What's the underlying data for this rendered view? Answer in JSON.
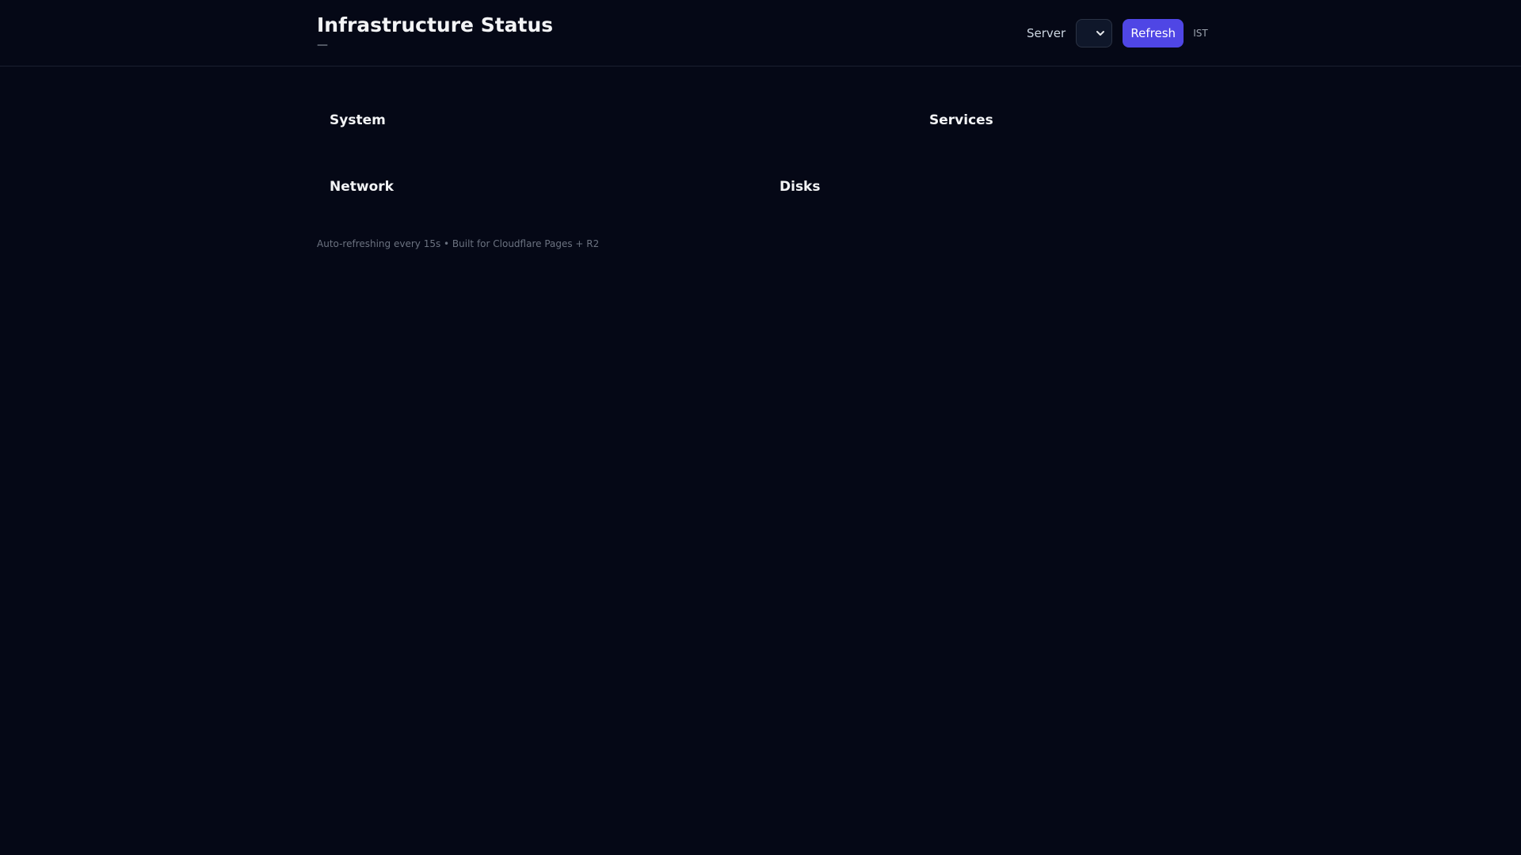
{
  "header": {
    "title": "Infrastructure Status",
    "subtitle": "—"
  },
  "controls": {
    "server_label": "Server",
    "server_selected": "",
    "refresh_label": "Refresh",
    "timezone": "IST"
  },
  "sections": {
    "system": "System",
    "services": "Services",
    "network": "Network",
    "disks": "Disks"
  },
  "footer": {
    "text": "Auto-refreshing every 15s • Built for Cloudflare Pages + R2"
  },
  "colors": {
    "background": "#050816",
    "accent": "#4f46e5"
  }
}
